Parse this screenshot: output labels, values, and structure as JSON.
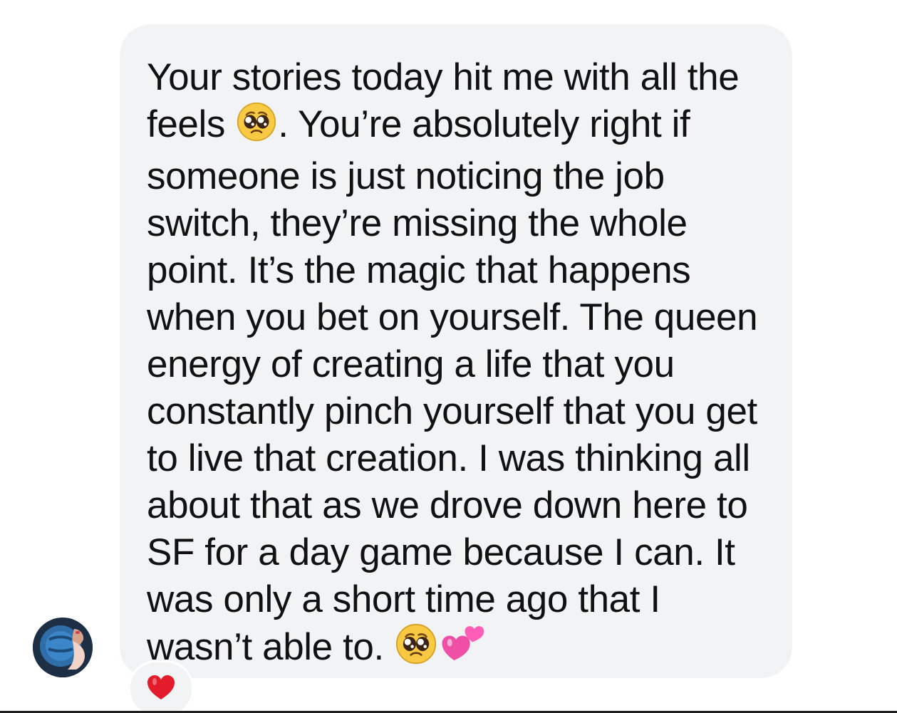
{
  "message": {
    "segments": [
      "Your stories today hit me with all the feels ",
      ". You’re absolutely right if someone is just noticing the job switch, they’re missing the whole point. It’s the magic that happens when you bet on yourself. The queen energy of creating a life that you constantly pinch yourself that you get to live that creation. I was thinking all about that as we drove down here to SF for a day game because I can. It was only a short time ago that I wasn’t able to. "
    ],
    "emojis": [
      "pleading-face-emoji",
      "pleading-face-emoji",
      "two-hearts-emoji"
    ]
  },
  "reaction": {
    "icon": "red-heart-icon"
  },
  "avatar": {
    "icon": "profile-photo"
  },
  "colors": {
    "bubble": "#f2f3f5",
    "text": "#111111",
    "heart": "#e31b2a",
    "pink_heart": "#f04fa8"
  }
}
